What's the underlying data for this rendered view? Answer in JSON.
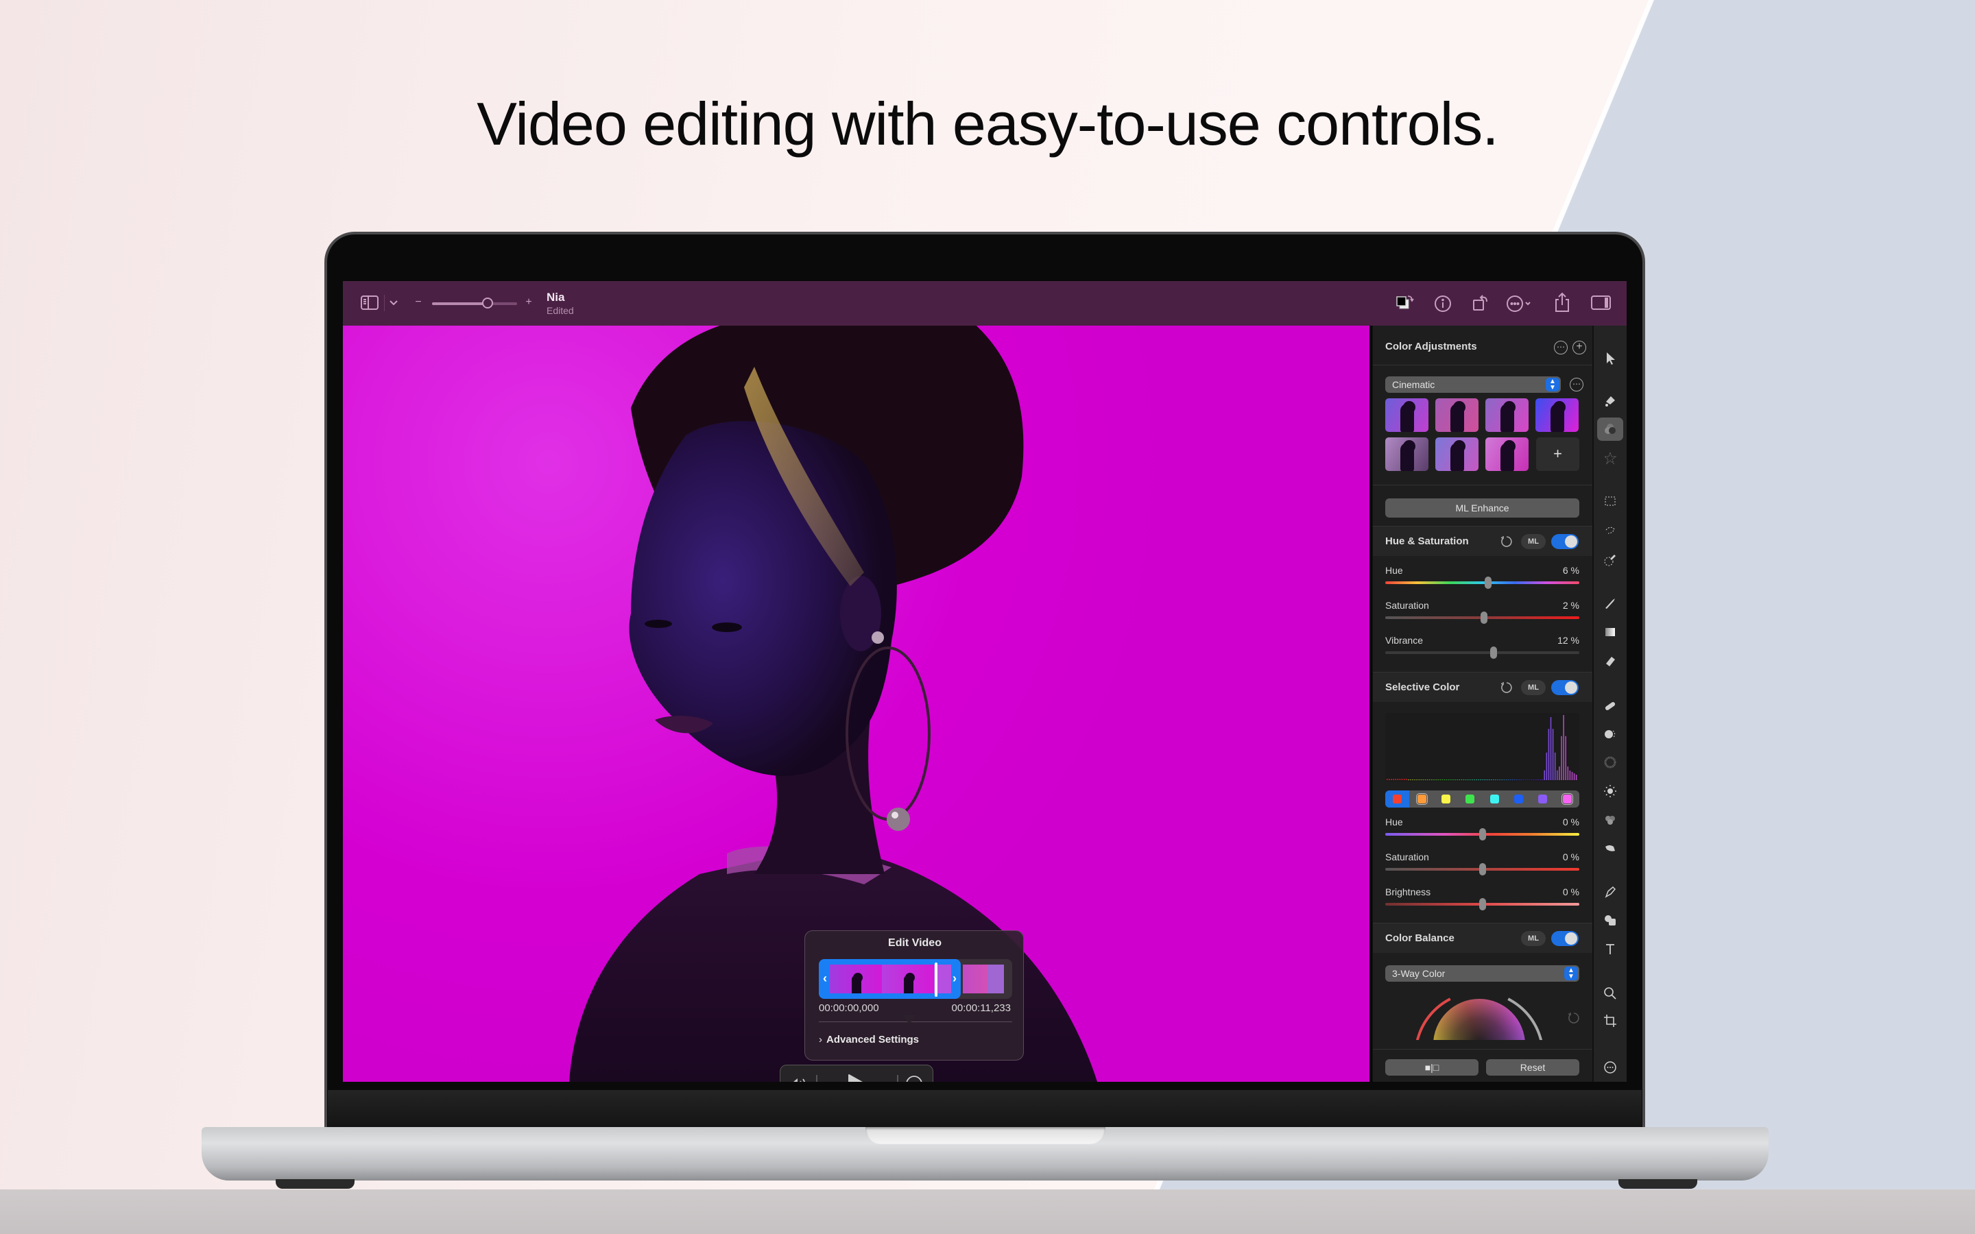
{
  "headline": "Video editing with easy-to-use controls.",
  "window": {
    "toolbar": {
      "sidebar_toggle_icon": "sidebar-icon",
      "sidebar_menu_icon": "chevron-down-icon",
      "zoom_out_label": "−",
      "zoom_in_label": "+",
      "zoom_level": 0.65,
      "document_title": "Nia",
      "document_status": "Edited",
      "right_icons": [
        "swap-colors-icon",
        "info-icon",
        "rotate-icon",
        "more-menu-icon",
        "share-icon",
        "inspector-toggle-icon"
      ]
    },
    "edit_video": {
      "title": "Edit Video",
      "start_time": "00:00:00,000",
      "end_time": "00:00:11,233",
      "advanced_settings_label": "Advanced Settings",
      "trim_start_icon": "chevron-left-icon",
      "trim_end_icon": "chevron-right-icon"
    },
    "playback": {
      "volume_icon": "speaker-icon",
      "play_icon": "play-icon",
      "more_icon": "ellipsis-circle-icon"
    },
    "panel": {
      "title": "Color Adjustments",
      "preset_selector": "Cinematic",
      "presets": [
        {
          "name": "preset-1",
          "colors": [
            "#6d5ed8",
            "#c13fd0"
          ]
        },
        {
          "name": "preset-2",
          "colors": [
            "#a45bb5",
            "#d04f9a"
          ]
        },
        {
          "name": "preset-3",
          "colors": [
            "#8b68c7",
            "#d846c6"
          ]
        },
        {
          "name": "preset-4",
          "colors": [
            "#3b4ef0",
            "#e020d8"
          ]
        },
        {
          "name": "preset-5",
          "colors": [
            "#b28ac5",
            "#5a3d6b"
          ]
        },
        {
          "name": "preset-6",
          "colors": [
            "#7c78d8",
            "#c758c2"
          ]
        },
        {
          "name": "preset-7",
          "colors": [
            "#d07ad8",
            "#c82fb5"
          ]
        }
      ],
      "add_preset_label": "+",
      "ml_enhance_label": "ML Enhance",
      "ml_label": "ML",
      "hue_saturation": {
        "title": "Hue & Saturation",
        "enabled": true,
        "sliders": [
          {
            "label": "Hue",
            "value": "6 %",
            "position": 0.53
          },
          {
            "label": "Saturation",
            "value": "2 %",
            "position": 0.51
          },
          {
            "label": "Vibrance",
            "value": "12 %",
            "position": 0.56
          }
        ]
      },
      "selective_color": {
        "title": "Selective Color",
        "enabled": true,
        "swatches": [
          "#f5402e",
          "#ff9a3a",
          "#f8f44a",
          "#3fe34d",
          "#3ff2f2",
          "#1d60f5",
          "#8a5cf5",
          "#f763f2"
        ],
        "selected_swatch": 0,
        "sliders": [
          {
            "label": "Hue",
            "value": "0 %",
            "position": 0.5
          },
          {
            "label": "Saturation",
            "value": "0 %",
            "position": 0.5
          },
          {
            "label": "Brightness",
            "value": "0 %",
            "position": 0.5
          }
        ]
      },
      "color_balance": {
        "title": "Color Balance",
        "enabled": true,
        "mode": "3-Way Color"
      },
      "compare_label": "■|□",
      "reset_label": "Reset"
    },
    "tools": [
      "pointer-tool-icon",
      "paint-bucket-icon",
      "color-adjust-icon",
      "effects-icon",
      "rect-select-icon",
      "lasso-select-icon",
      "magic-select-icon",
      "brush-icon",
      "gradient-icon",
      "eraser-icon",
      "heal-icon",
      "clone-icon",
      "noise-icon",
      "light-icon",
      "color-mix-icon",
      "smudge-icon",
      "pen-icon",
      "shapes-icon",
      "text-icon",
      "zoom-icon",
      "crop-icon",
      "more-tools-icon"
    ],
    "active_tool": 2
  }
}
